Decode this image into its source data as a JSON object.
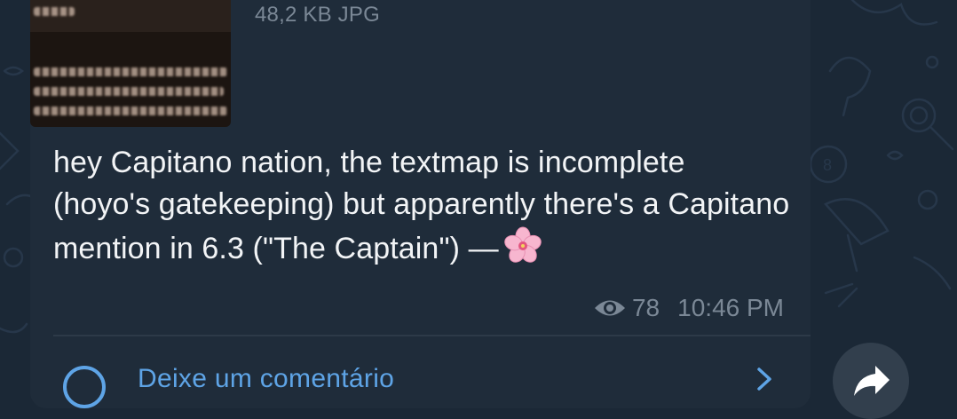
{
  "attachment": {
    "file_info": "48,2 KB JPG",
    "thumbnail_lines": [
      "ngm!'",
      "and smells lägund who se",
      "atolk, who adopted mi one",
      "ne who won't stop nagging"
    ]
  },
  "message": {
    "text": "hey Capitano nation, the textmap is incomplete (hoyo's gatekeeping) but apparently there's a Capitano mention in 6.3 (\"The Captain\") —",
    "emoji": "cherry-blossom"
  },
  "meta": {
    "views": "78",
    "time": "10:46 PM"
  },
  "comments": {
    "label": "Deixe um comentário"
  },
  "colors": {
    "background": "#1b2836",
    "bubble": "#1f2c3a",
    "link": "#5ea4e6",
    "secondary_text": "#7b8896"
  }
}
